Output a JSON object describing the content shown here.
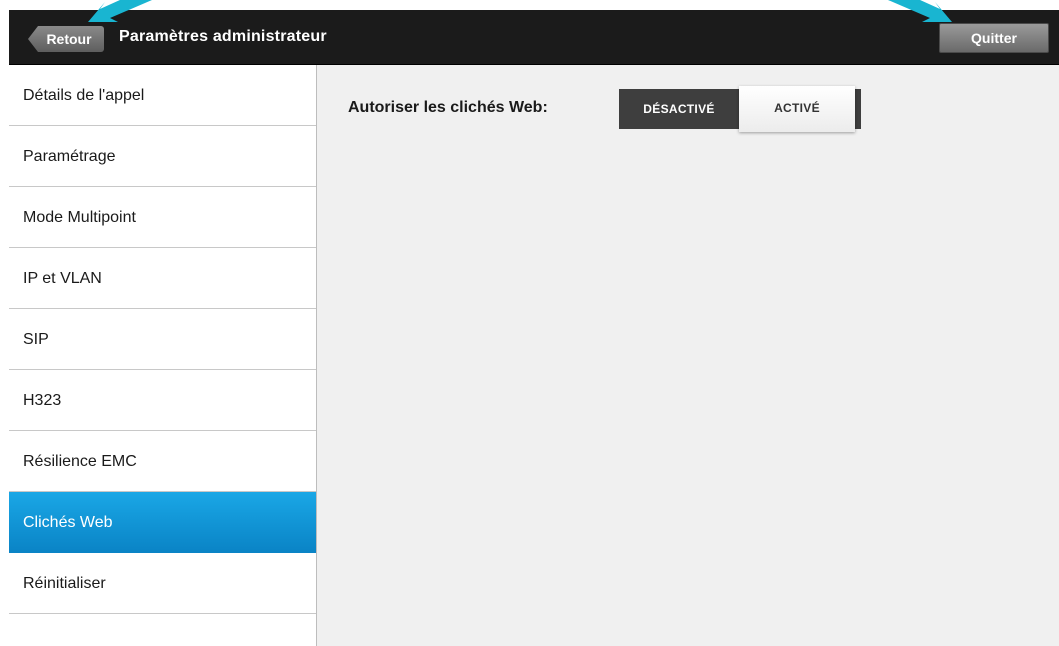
{
  "header": {
    "back_label": "Retour",
    "title": "Paramètres administrateur",
    "quit_label": "Quitter"
  },
  "sidebar": {
    "items": [
      {
        "label": "Détails de l'appel",
        "active": false
      },
      {
        "label": "Paramétrage",
        "active": false
      },
      {
        "label": "Mode Multipoint",
        "active": false
      },
      {
        "label": "IP et VLAN",
        "active": false
      },
      {
        "label": "SIP",
        "active": false
      },
      {
        "label": "H323",
        "active": false
      },
      {
        "label": "Résilience EMC",
        "active": false
      },
      {
        "label": "Clichés Web",
        "active": true
      },
      {
        "label": "Réinitialiser",
        "active": false
      }
    ]
  },
  "main": {
    "setting_label": "Autoriser les clichés Web:",
    "toggle": {
      "off_label": "DÉSACTIVÉ",
      "on_label": "ACTIVÉ",
      "selected": "ACTIVÉ"
    }
  },
  "colors": {
    "accent": "#0a94d8",
    "header_bg": "#1b1b1b",
    "annotation_arrow": "#19b5d1"
  }
}
